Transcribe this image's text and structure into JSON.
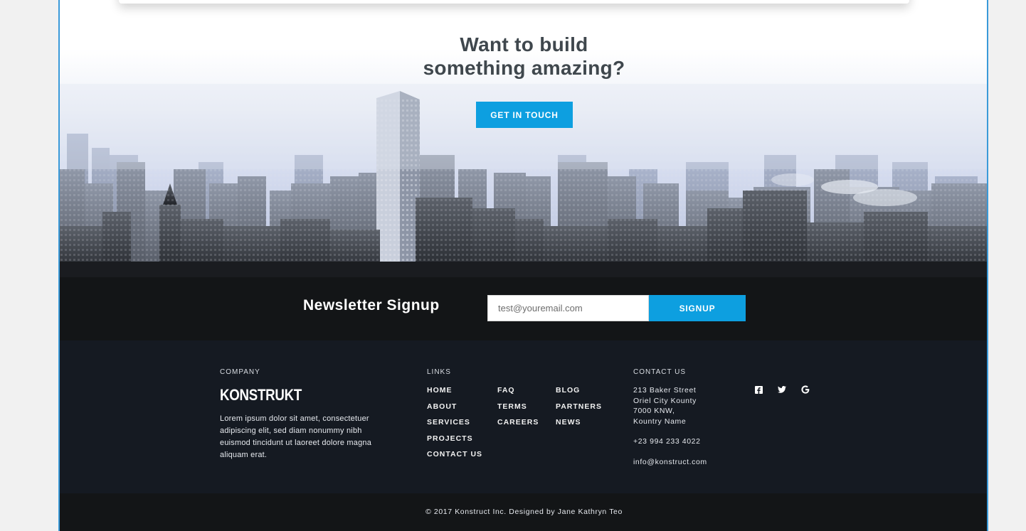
{
  "hero": {
    "title_line1": "Want to build",
    "title_line2": "something amazing?",
    "cta_label": "GET IN TOUCH"
  },
  "newsletter": {
    "title": "Newsletter Signup",
    "email_placeholder": "test@youremail.com",
    "signup_label": "SIGNUP"
  },
  "footer": {
    "company": {
      "heading": "COMPANY",
      "logo_text": "KONSTRUKT",
      "description": "Lorem ipsum dolor sit amet, consectetuer adipiscing elit, sed diam nonummy nibh euismod tincidunt ut laoreet dolore magna aliquam erat."
    },
    "links": {
      "heading": "LINKS",
      "col1": [
        "HOME",
        "ABOUT",
        "SERVICES",
        "PROJECTS",
        "CONTACT US"
      ],
      "col2": [
        "FAQ",
        "TERMS",
        "CAREERS"
      ],
      "col3": [
        "BLOG",
        "PARTNERS",
        "NEWS"
      ]
    },
    "contact": {
      "heading": "CONTACT US",
      "address": [
        "213 Baker Street",
        "Oriel City Kounty",
        "7000 KNW,",
        "Kountry Name"
      ],
      "phone": "+23 994 233 4022",
      "email": "info@konstruct.com"
    },
    "social": [
      "facebook-icon",
      "twitter-icon",
      "google-icon"
    ],
    "copyright": "© 2017 Konstruct Inc. Designed by Jane Kathryn Teo"
  },
  "colors": {
    "accent": "#0d9fe0",
    "dark": "#131517",
    "footer_bg": "#151a22",
    "heading": "#3f474d",
    "frame_border": "#3a9ad9"
  }
}
